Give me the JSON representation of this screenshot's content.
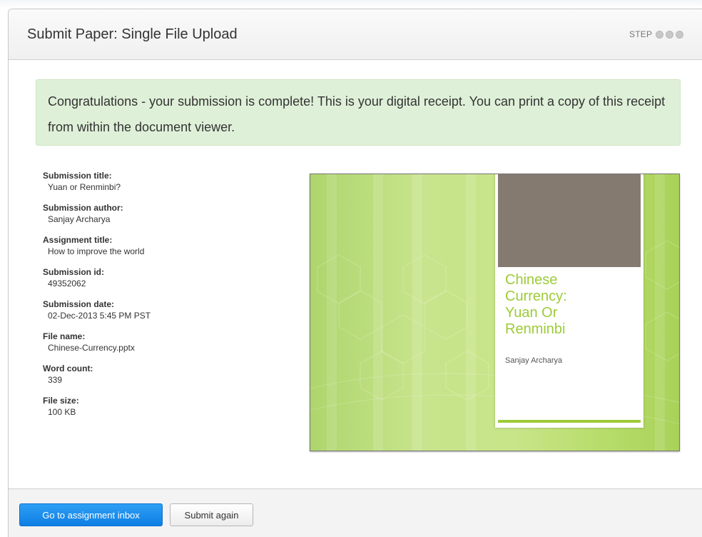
{
  "header": {
    "title": "Submit Paper: Single File Upload",
    "step_label": "STEP"
  },
  "alert": {
    "message": "Congratulations - your submission is complete! This is your digital receipt. You can print a copy of this receipt from within the document viewer."
  },
  "details": [
    {
      "label": "Submission title:",
      "value": "Yuan or Renminbi?"
    },
    {
      "label": "Submission author:",
      "value": "Sanjay Archarya"
    },
    {
      "label": "Assignment title:",
      "value": "How to improve the world"
    },
    {
      "label": "Submission id:",
      "value": "49352062"
    },
    {
      "label": "Submission date:",
      "value": "02-Dec-2013 5:45 PM PST"
    },
    {
      "label": "File name:",
      "value": "Chinese-Currency.pptx"
    },
    {
      "label": "Word count:",
      "value": "339"
    },
    {
      "label": "File size:",
      "value": "100 KB"
    }
  ],
  "preview": {
    "slide_title_lines": [
      "Chinese",
      "Currency:",
      "Yuan Or",
      "Renminbi"
    ],
    "slide_author": "Sanjay Archarya",
    "accent_color": "#9dcb38"
  },
  "footer": {
    "primary_label": "Go to assignment inbox",
    "secondary_label": "Submit again"
  },
  "colors": {
    "primary_button": "#1a8cf0",
    "alert_background": "#dff0d8"
  }
}
